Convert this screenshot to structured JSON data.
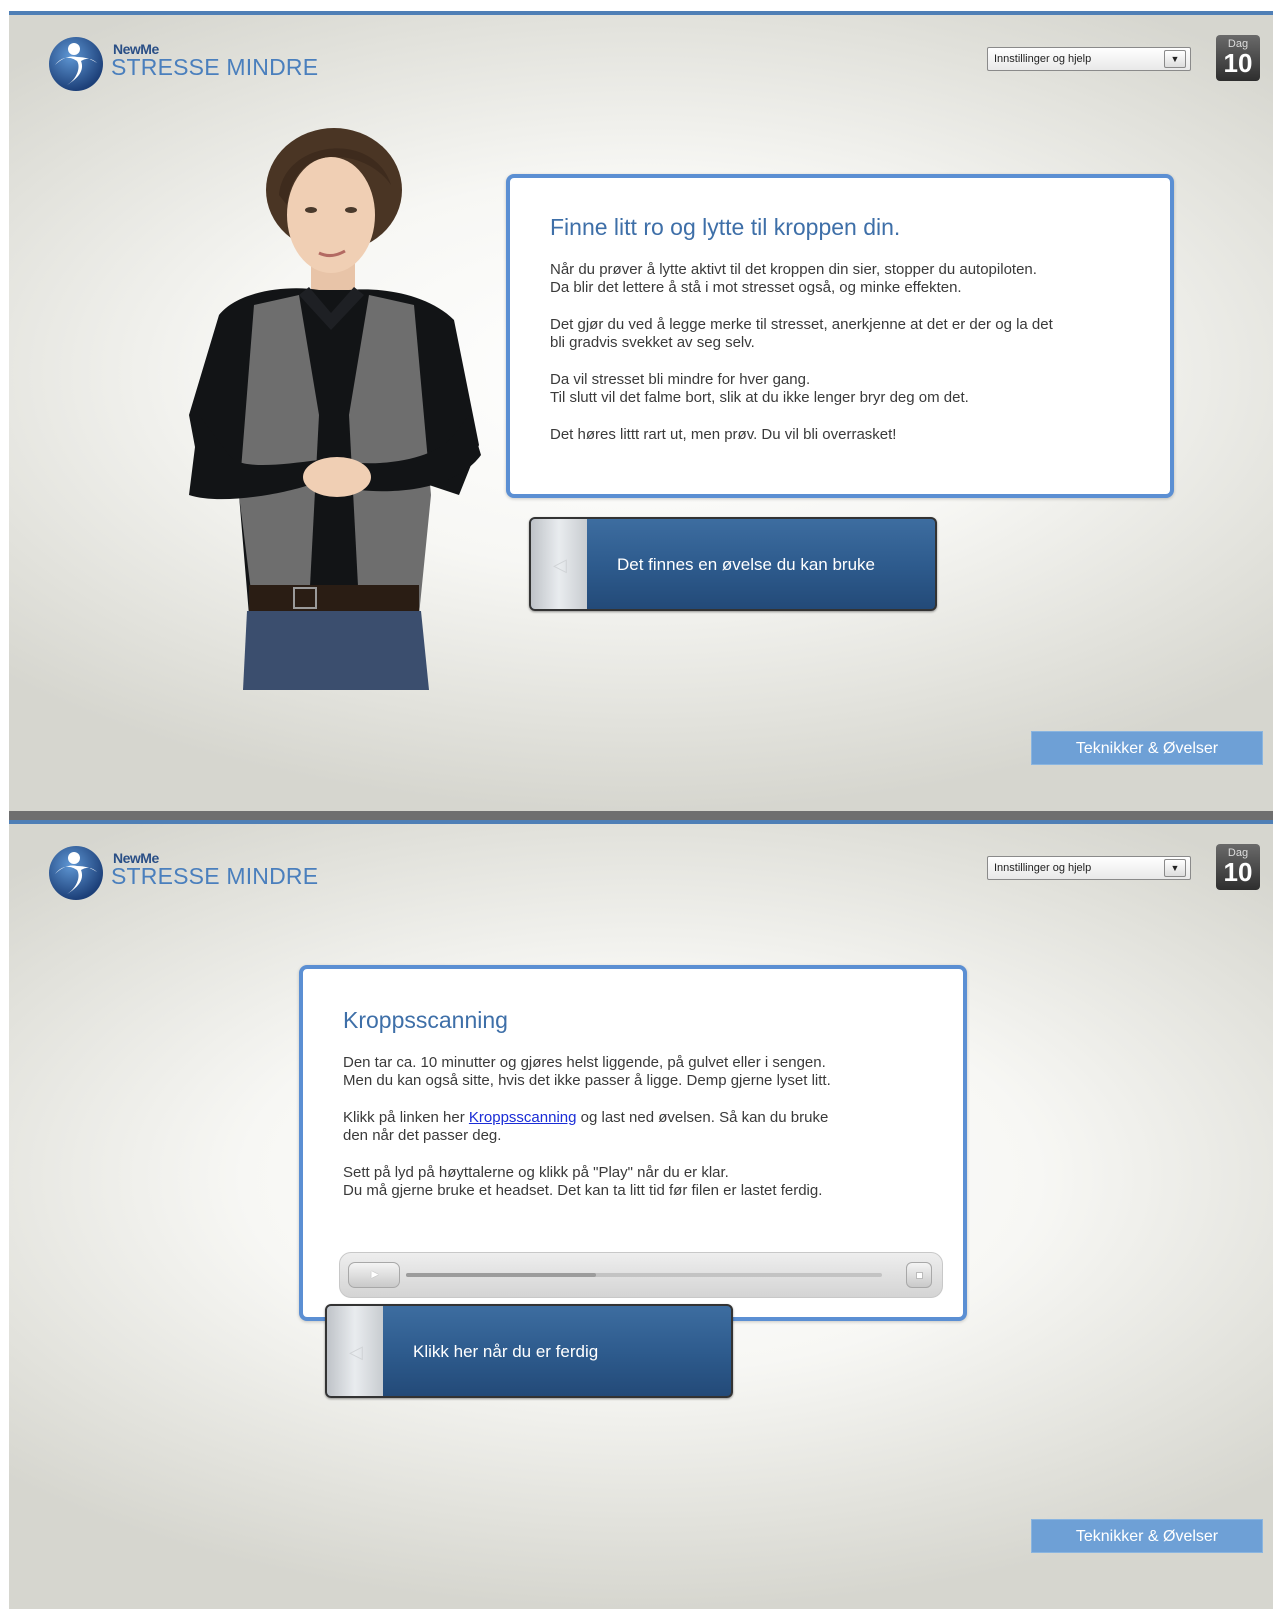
{
  "app": {
    "brand": "NewMe",
    "product": "STRESSE MINDRE",
    "settings_label": "Innstillinger og hjelp",
    "day_label": "Dag",
    "day_number": "10",
    "techniques_label": "Teknikker & Øvelser",
    "accent_color": "#5b8fd3"
  },
  "screen1": {
    "title": "Finne litt ro og lytte til kroppen din.",
    "paragraphs": [
      [
        "Når du prøver å lytte aktivt til det kroppen din sier, stopper du autopiloten.",
        "Da blir det lettere å stå i mot stresset også, og minke effekten."
      ],
      [
        "Det gjør du ved å legge merke til stresset, anerkjenne at det er der og la det",
        "bli gradvis svekket av seg selv."
      ],
      [
        "Da vil stresset bli mindre for hver gang.",
        "Til slutt vil det falme bort, slik at du ikke lenger bryr deg om det."
      ],
      [
        "Det høres littt rart ut, men prøv. Du vil bli overrasket!"
      ]
    ],
    "nav_button": "Det finnes en øvelse du kan bruke"
  },
  "screen2": {
    "title": "Kroppsscanning",
    "p1": [
      "Den tar ca. 10 minutter og gjøres helst liggende, på gulvet eller i sengen.",
      "Men du kan også sitte, hvis det ikke passer å ligge. Demp gjerne lyset litt."
    ],
    "p2_before": "Klikk på linken her ",
    "p2_link": "Kroppsscanning",
    "p2_after": " og last ned øvelsen. Så kan du bruke",
    "p2_line2": "den når det passer deg.",
    "p3": [
      "Sett på lyd på høyttalerne og klikk på \"Play\" når du er klar.",
      "Du må gjerne bruke et headset. Det kan ta litt tid før filen er lastet ferdig."
    ],
    "player_progress": 0.4,
    "nav_button": "Klikk her når du er ferdig"
  }
}
